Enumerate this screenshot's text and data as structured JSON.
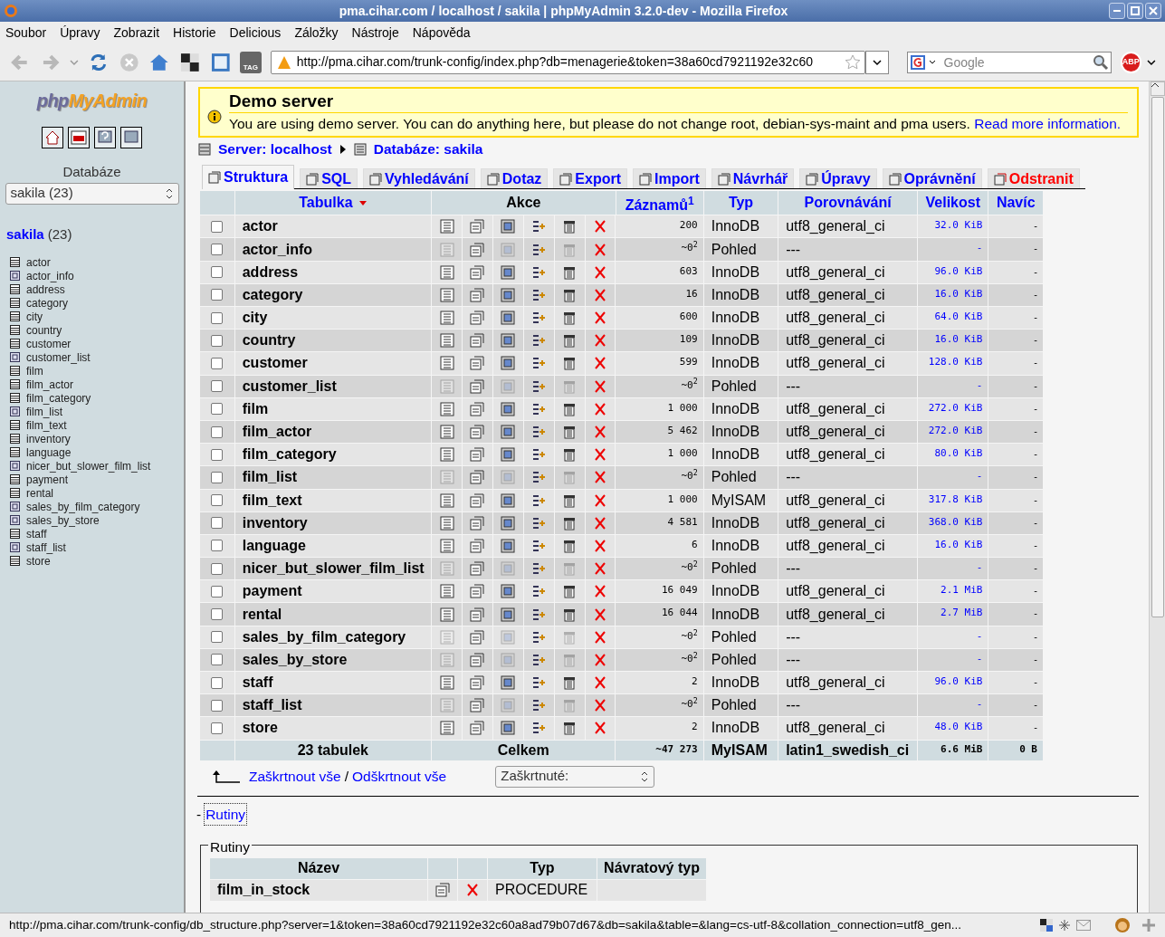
{
  "window": {
    "title": "pma.cihar.com / localhost / sakila | phpMyAdmin 3.2.0-dev - Mozilla Firefox"
  },
  "menu": [
    "Soubor",
    "Úpravy",
    "Zobrazit",
    "Historie",
    "Delicious",
    "Záložky",
    "Nástroje",
    "Nápověda"
  ],
  "address_bar": {
    "value": "http://pma.cihar.com/trunk-config/index.php?db=menagerie&token=38a60cd7921192e32c60"
  },
  "search": {
    "placeholder": "Google"
  },
  "toolbar": {
    "abp": "ABP",
    "tag": "TAG"
  },
  "sidebar": {
    "logo_php": "php",
    "logo_rest": "MyAdmin",
    "db_label": "Databáze",
    "db_select": "sakila (23)",
    "db_name": "sakila",
    "db_count": "(23)",
    "items": [
      {
        "label": "actor",
        "kind": "table"
      },
      {
        "label": "actor_info",
        "kind": "view"
      },
      {
        "label": "address",
        "kind": "table"
      },
      {
        "label": "category",
        "kind": "table"
      },
      {
        "label": "city",
        "kind": "table"
      },
      {
        "label": "country",
        "kind": "table"
      },
      {
        "label": "customer",
        "kind": "table"
      },
      {
        "label": "customer_list",
        "kind": "view"
      },
      {
        "label": "film",
        "kind": "table"
      },
      {
        "label": "film_actor",
        "kind": "table"
      },
      {
        "label": "film_category",
        "kind": "table"
      },
      {
        "label": "film_list",
        "kind": "view"
      },
      {
        "label": "film_text",
        "kind": "table"
      },
      {
        "label": "inventory",
        "kind": "table"
      },
      {
        "label": "language",
        "kind": "table"
      },
      {
        "label": "nicer_but_slower_film_list",
        "kind": "view"
      },
      {
        "label": "payment",
        "kind": "table"
      },
      {
        "label": "rental",
        "kind": "table"
      },
      {
        "label": "sales_by_film_category",
        "kind": "view"
      },
      {
        "label": "sales_by_store",
        "kind": "view"
      },
      {
        "label": "staff",
        "kind": "table"
      },
      {
        "label": "staff_list",
        "kind": "view"
      },
      {
        "label": "store",
        "kind": "table"
      }
    ]
  },
  "notice": {
    "title": "Demo server",
    "text": "You are using demo server. You can do anything here, but please do not change root, debian-sys-maint and pma users.",
    "link": "Read more information."
  },
  "breadcrumb": [
    "Server: localhost",
    "Databáze: sakila"
  ],
  "tabs": [
    {
      "label": "Struktura",
      "selected": true,
      "kind": "normal"
    },
    {
      "label": "SQL",
      "selected": false,
      "kind": "normal"
    },
    {
      "label": "Vyhledávání",
      "selected": false,
      "kind": "normal"
    },
    {
      "label": "Dotaz",
      "selected": false,
      "kind": "normal"
    },
    {
      "label": "Export",
      "selected": false,
      "kind": "normal"
    },
    {
      "label": "Import",
      "selected": false,
      "kind": "normal"
    },
    {
      "label": "Návrhář",
      "selected": false,
      "kind": "normal"
    },
    {
      "label": "Úpravy",
      "selected": false,
      "kind": "normal"
    },
    {
      "label": "Oprávnění",
      "selected": false,
      "kind": "normal"
    },
    {
      "label": "Odstranit",
      "selected": false,
      "kind": "danger"
    }
  ],
  "table": {
    "columns": [
      "Tabulka",
      "Akce",
      "Záznamů$^{1}$",
      "Typ",
      "Porovnávání",
      "Velikost",
      "Navíc"
    ],
    "rows": [
      {
        "name": "actor",
        "kind": "table",
        "checked": false,
        "records": "200",
        "type": "InnoDB",
        "collation": "utf8_general_ci",
        "size": "32.0 KiB",
        "overhead": "-"
      },
      {
        "name": "actor_info",
        "kind": "view",
        "checked": false,
        "records": "~0$^{2}$",
        "type": "Pohled",
        "collation": "---",
        "size": "-",
        "overhead": "-"
      },
      {
        "name": "address",
        "kind": "table",
        "checked": false,
        "records": "603",
        "type": "InnoDB",
        "collation": "utf8_general_ci",
        "size": "96.0 KiB",
        "overhead": "-"
      },
      {
        "name": "category",
        "kind": "table",
        "checked": false,
        "records": "16",
        "type": "InnoDB",
        "collation": "utf8_general_ci",
        "size": "16.0 KiB",
        "overhead": "-"
      },
      {
        "name": "city",
        "kind": "table",
        "checked": false,
        "records": "600",
        "type": "InnoDB",
        "collation": "utf8_general_ci",
        "size": "64.0 KiB",
        "overhead": "-"
      },
      {
        "name": "country",
        "kind": "table",
        "checked": false,
        "records": "109",
        "type": "InnoDB",
        "collation": "utf8_general_ci",
        "size": "16.0 KiB",
        "overhead": "-"
      },
      {
        "name": "customer",
        "kind": "table",
        "checked": false,
        "records": "599",
        "type": "InnoDB",
        "collation": "utf8_general_ci",
        "size": "128.0 KiB",
        "overhead": "-"
      },
      {
        "name": "customer_list",
        "kind": "view",
        "checked": false,
        "records": "~0$^{2}$",
        "type": "Pohled",
        "collation": "---",
        "size": "-",
        "overhead": "-"
      },
      {
        "name": "film",
        "kind": "table",
        "checked": false,
        "records": "1 000",
        "type": "InnoDB",
        "collation": "utf8_general_ci",
        "size": "272.0 KiB",
        "overhead": "-"
      },
      {
        "name": "film_actor",
        "kind": "table",
        "checked": false,
        "records": "5 462",
        "type": "InnoDB",
        "collation": "utf8_general_ci",
        "size": "272.0 KiB",
        "overhead": "-"
      },
      {
        "name": "film_category",
        "kind": "table",
        "checked": false,
        "records": "1 000",
        "type": "InnoDB",
        "collation": "utf8_general_ci",
        "size": "80.0 KiB",
        "overhead": "-"
      },
      {
        "name": "film_list",
        "kind": "view",
        "checked": false,
        "records": "~0$^{2}$",
        "type": "Pohled",
        "collation": "---",
        "size": "-",
        "overhead": "-"
      },
      {
        "name": "film_text",
        "kind": "table",
        "checked": false,
        "records": "1 000",
        "type": "MyISAM",
        "collation": "utf8_general_ci",
        "size": "317.8 KiB",
        "overhead": "-"
      },
      {
        "name": "inventory",
        "kind": "table",
        "checked": false,
        "records": "4 581",
        "type": "InnoDB",
        "collation": "utf8_general_ci",
        "size": "368.0 KiB",
        "overhead": "-"
      },
      {
        "name": "language",
        "kind": "table",
        "checked": false,
        "records": "6",
        "type": "InnoDB",
        "collation": "utf8_general_ci",
        "size": "16.0 KiB",
        "overhead": "-"
      },
      {
        "name": "nicer_but_slower_film_list",
        "kind": "view",
        "checked": false,
        "records": "~0$^{2}$",
        "type": "Pohled",
        "collation": "---",
        "size": "-",
        "overhead": "-"
      },
      {
        "name": "payment",
        "kind": "table",
        "checked": false,
        "records": "16 049",
        "type": "InnoDB",
        "collation": "utf8_general_ci",
        "size": "2.1 MiB",
        "overhead": "-"
      },
      {
        "name": "rental",
        "kind": "table",
        "checked": false,
        "records": "16 044",
        "type": "InnoDB",
        "collation": "utf8_general_ci",
        "size": "2.7 MiB",
        "overhead": "-"
      },
      {
        "name": "sales_by_film_category",
        "kind": "view",
        "checked": false,
        "records": "~0$^{2}$",
        "type": "Pohled",
        "collation": "---",
        "size": "-",
        "overhead": "-"
      },
      {
        "name": "sales_by_store",
        "kind": "view",
        "checked": false,
        "records": "~0$^{2}$",
        "type": "Pohled",
        "collation": "---",
        "size": "-",
        "overhead": "-"
      },
      {
        "name": "staff",
        "kind": "table",
        "checked": false,
        "records": "2",
        "type": "InnoDB",
        "collation": "utf8_general_ci",
        "size": "96.0 KiB",
        "overhead": "-"
      },
      {
        "name": "staff_list",
        "kind": "view",
        "checked": false,
        "records": "~0$^{2}$",
        "type": "Pohled",
        "collation": "---",
        "size": "-",
        "overhead": "-"
      },
      {
        "name": "store",
        "kind": "table",
        "checked": false,
        "records": "2",
        "type": "InnoDB",
        "collation": "utf8_general_ci",
        "size": "48.0 KiB",
        "overhead": "-"
      }
    ],
    "footer": [
      "23 tabulek",
      "Celkem",
      "~47 273",
      "MyISAM",
      "latin1_swedish_ci",
      "6.6 MiB",
      "0 B"
    ]
  },
  "bulk": {
    "check_all": "Zaškrtnout vše",
    "separator": "/",
    "uncheck_all": "Odškrtnout vše",
    "select": "Zaškrtnuté:"
  },
  "routines_link": {
    "dash": "-",
    "label": "Rutiny"
  },
  "routines": {
    "legend": "Rutiny",
    "columns": [
      "Název",
      "Typ",
      "Návratový typ"
    ],
    "rows": [
      {
        "name": "film_in_stock",
        "type": "PROCEDURE",
        "returns": ""
      }
    ]
  },
  "status_bar": {
    "text": "http://pma.cihar.com/trunk-config/db_structure.php?server=1&token=38a60cd7921192e32c60a8ad79b07d67&db=sakila&table=&lang=cs-utf-8&collation_connection=utf8_gen..."
  }
}
